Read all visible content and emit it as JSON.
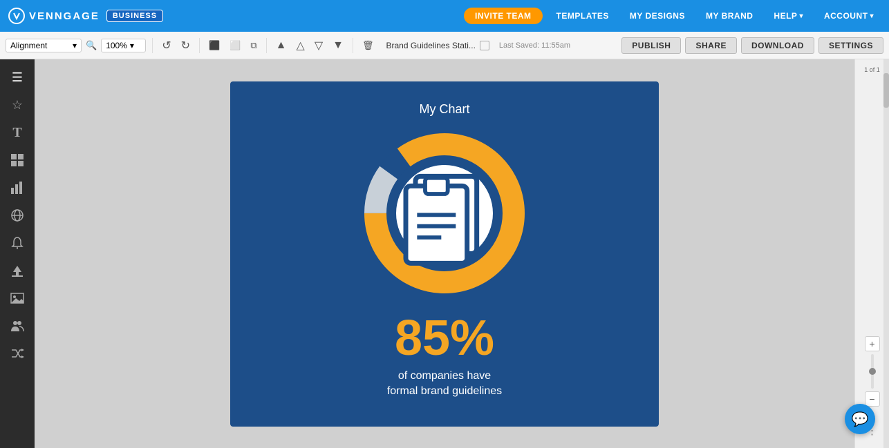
{
  "nav": {
    "brand": "VENNGAGE",
    "business_badge": "BUSINESS",
    "invite_btn": "INVITE TEAM",
    "links": [
      {
        "label": "TEMPLATES",
        "has_caret": false
      },
      {
        "label": "MY DESIGNS",
        "has_caret": false
      },
      {
        "label": "MY BRAND",
        "has_caret": false
      },
      {
        "label": "HELP",
        "has_caret": true
      },
      {
        "label": "ACCOUNT",
        "has_caret": true
      }
    ]
  },
  "toolbar": {
    "alignment_label": "Alignment",
    "zoom_label": "100%",
    "doc_title": "Brand Guidelines Stati...",
    "doc_saved": "Last Saved: 11:55am",
    "buttons": {
      "publish": "PUBLISH",
      "share": "SHARE",
      "download": "DOWNLOAD",
      "settings": "SETTINGS"
    }
  },
  "sidebar_left": {
    "icons": [
      {
        "name": "menu-icon",
        "symbol": "☰"
      },
      {
        "name": "star-icon",
        "symbol": "★"
      },
      {
        "name": "text-icon",
        "symbol": "T"
      },
      {
        "name": "widgets-icon",
        "symbol": "⊞"
      },
      {
        "name": "chart-icon",
        "symbol": "📊"
      },
      {
        "name": "globe-icon",
        "symbol": "🌐"
      },
      {
        "name": "bell-icon",
        "symbol": "🔔"
      },
      {
        "name": "upload-icon",
        "symbol": "⬆"
      },
      {
        "name": "image-icon",
        "symbol": "🖼"
      },
      {
        "name": "people-icon",
        "symbol": "👥"
      },
      {
        "name": "shuffle-icon",
        "symbol": "⇄"
      }
    ]
  },
  "infographic": {
    "title": "My Chart",
    "percent": "85%",
    "line1": "of companies have",
    "line2": "formal brand guidelines",
    "donut": {
      "total_degrees": 360,
      "filled_degrees": 306,
      "filled_color": "#f5a623",
      "unfilled_color": "#e0e0e0",
      "ring_color": "#1d4e89",
      "center_bg": "white"
    }
  },
  "right_sidebar": {
    "page_indicator": "1 of 1",
    "zoom_plus": "+",
    "zoom_minus": "−"
  },
  "chat": {
    "icon": "💬"
  }
}
